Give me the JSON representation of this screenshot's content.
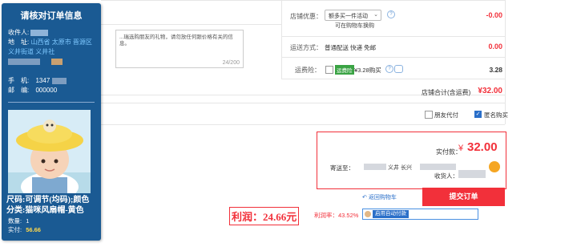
{
  "panel": {
    "title": "请核对订单信息",
    "recipient_label": "收件人:",
    "address_label": "地　址:",
    "address_value": "山西省 太原市 晋源区",
    "address_line2": "义井街道 义井社",
    "phone_label": "手　机:",
    "phone_value": "1347",
    "zip_label": "邮　编:",
    "zip_value": "000000",
    "spec_line1": "尺码:可调节(均码);颜色",
    "spec_line2": "分类:猫咪风扇帽-黄色",
    "quantity_label": "数量:",
    "quantity_value": "1",
    "paid_label": "实付:",
    "paid_value": "56.66"
  },
  "order": {
    "message_text": "...瑞选购朋友的礼物，请勿放任何跟价格有关的信息。",
    "char_count": "24/200",
    "discount_label": "店铺优惠：",
    "discount_select": "额多买一件活动",
    "discount_hint": "可在购物车换购",
    "discount_value": "-0.00",
    "shipping_label": "运送方式：",
    "shipping_value": "普通配送 快递 免邮",
    "shipping_price": "0.00",
    "insurance_label": "运费险：",
    "insurance_badge": "运费险",
    "insurance_price_text": "¥3.28购买",
    "insurance_total": "3.28",
    "store_total_label": "店铺合计(含运费)",
    "store_total_value": "¥32.00"
  },
  "options": {
    "friend_pay": "朋友代付",
    "anonymous": "匿名购买"
  },
  "summary": {
    "paid_label": "实付款：",
    "currency": "¥",
    "amount": "32.00",
    "ship_to_label": "寄送至：",
    "address_partial": "义井 长兴",
    "receiver_label": "收货人："
  },
  "actions": {
    "back_to_cart": "返回购物车",
    "submit": "提交订单"
  },
  "profit": {
    "profit_label": "利润：24.66元",
    "rate_label": "利润率：43.52%",
    "auto_pay_button": "启用自动付款"
  },
  "colors": {
    "panel": "#1a5a93",
    "accent_red": "#f2303a",
    "link_blue": "#2a6fc9",
    "green_badge": "#3aa344"
  },
  "icons": [
    "chevron-down-icon",
    "question-icon",
    "back-arrow-icon",
    "wangwang-icon",
    "avatar-icon"
  ]
}
